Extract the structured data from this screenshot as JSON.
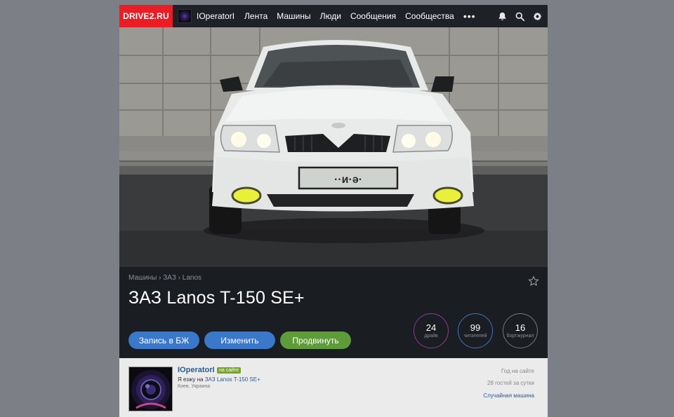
{
  "header": {
    "logo": "DRIVE2.RU",
    "username": "IOperatorI",
    "nav": [
      "Лента",
      "Машины",
      "Люди",
      "Сообщения",
      "Сообщества"
    ],
    "more": "•••",
    "icons": [
      "bell-icon",
      "search-icon",
      "gear-icon"
    ]
  },
  "car": {
    "breadcrumb": [
      "Машины",
      "ЗАЗ",
      "Lanos"
    ],
    "breadcrumb_sep": "›",
    "title": "ЗАЗ Lanos T-150 SE+",
    "plate": "··и·ә·",
    "buttons": {
      "logbook": "Запись в БЖ",
      "edit": "Изменить",
      "promote": "Продвинуть"
    },
    "stats": [
      {
        "value": "24",
        "label": "драйв",
        "color": "#8e3a9a"
      },
      {
        "value": "99",
        "label": "читателей",
        "color": "#3a78c9"
      },
      {
        "value": "16",
        "label": "бортжурнал",
        "color": "#777777"
      }
    ]
  },
  "owner": {
    "name": "IOperatorI",
    "online_badge": "на сайте",
    "drives_prefix": "Я езжу на",
    "drives_car": "ЗАЗ Lanos T-150 SE+",
    "location": "Киев, Украина",
    "years": "Год на сайте",
    "guests": "28 гостей за сутки",
    "random_car": "Случайная машина"
  },
  "colors": {
    "logo_bg": "#ec1c24",
    "header_bg": "#1e2126",
    "button_blue": "#3a78c9",
    "button_green": "#5e9c3a",
    "link": "#2b5a94"
  }
}
